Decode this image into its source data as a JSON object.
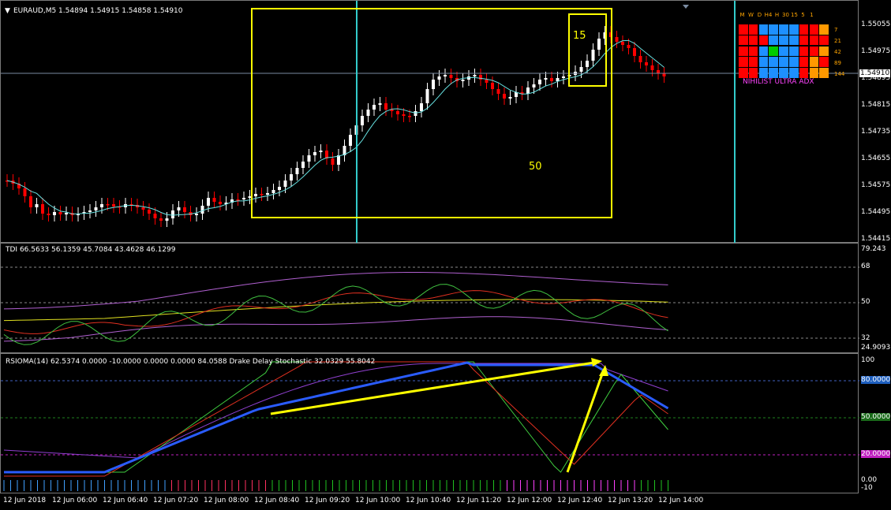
{
  "main": {
    "header": "EURAUD,M5  1.54894 1.54915 1.54858 1.54910",
    "price_labels": [
      "1.55055",
      "1.54975",
      "1.54895",
      "1.54815",
      "1.54735",
      "1.54655",
      "1.54575",
      "1.54495",
      "1.54415"
    ],
    "current_price": "1.54910",
    "box_big_label": "50",
    "box_small_label": "15",
    "adx": {
      "title": "NIHILIST ULTRA ADX",
      "headers": [
        "M",
        "W",
        "D",
        "H4",
        "H",
        "30",
        "15",
        "5",
        "1"
      ],
      "periods": [
        "7",
        "21",
        "42",
        "89",
        "144"
      ]
    }
  },
  "tdi": {
    "header": "TDI 66.5633 56.1359 45.7084 43.4628 46.1299",
    "labels": [
      "79.243",
      "68",
      "50",
      "32",
      "24.9093"
    ]
  },
  "rsioma": {
    "header": "RSIOMA(14) 62.5374 0.0000 -10.0000 0.0000 0.0000 84.0588  Drake Delay Stochastic 32.0329 55.8042",
    "labels": [
      "100",
      "80.0000",
      "50.0000",
      "20.0000",
      "0.00",
      "-10"
    ]
  },
  "time_labels": [
    "12 Jun 2018",
    "12 Jun 06:00",
    "12 Jun 06:40",
    "12 Jun 07:20",
    "12 Jun 08:00",
    "12 Jun 08:40",
    "12 Jun 09:20",
    "12 Jun 10:00",
    "12 Jun 10:40",
    "12 Jun 11:20",
    "12 Jun 12:00",
    "12 Jun 12:40",
    "12 Jun 13:20",
    "12 Jun 14:00"
  ],
  "colors": {
    "bull": "#ffffff",
    "bear": "#ff0000",
    "box": "#ffff00",
    "vline": "#33cccc",
    "ma": "#66e0e0",
    "rsioma": "#2a5cff",
    "adx_red": "#ff0000",
    "adx_blue": "#1e90ff",
    "adx_orange": "#ff9900",
    "adx_green": "#00cc00"
  }
}
